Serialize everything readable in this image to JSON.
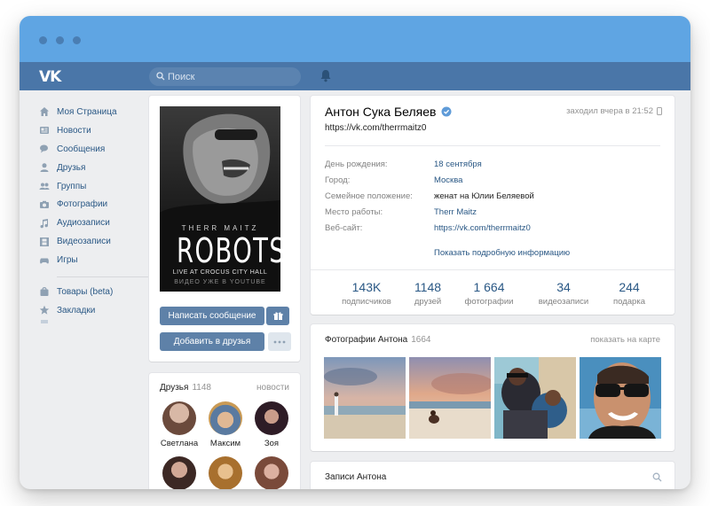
{
  "window": {
    "controls": [
      "close",
      "minimize",
      "maximize"
    ]
  },
  "header": {
    "logo": "VK",
    "search": {
      "placeholder": "Поиск"
    },
    "icons": [
      "search-icon",
      "bell-icon"
    ]
  },
  "sidebar": {
    "items": [
      {
        "label": "Моя Страница",
        "icon": "home-icon"
      },
      {
        "label": "Новости",
        "icon": "news-icon"
      },
      {
        "label": "Сообщения",
        "icon": "messages-icon"
      },
      {
        "label": "Друзья",
        "icon": "user-icon"
      },
      {
        "label": "Группы",
        "icon": "group-icon"
      },
      {
        "label": "Фотографии",
        "icon": "camera-icon"
      },
      {
        "label": "Аудиозаписи",
        "icon": "music-icon"
      },
      {
        "label": "Видеозаписи",
        "icon": "video-icon"
      },
      {
        "label": "Игры",
        "icon": "gamepad-icon"
      }
    ],
    "extra_items": [
      {
        "label": "Товары (beta)",
        "icon": "shopping-bag-icon"
      },
      {
        "label": "Закладки",
        "icon": "star-icon"
      }
    ]
  },
  "cover": {
    "brand": "THERR MAITZ",
    "title": "ROBOTS",
    "subtitle": "LIVE AT CROCUS CITY HALL",
    "note": "ВИДЕО УЖЕ В YOUTUBE"
  },
  "actions": {
    "message": "Написать сообщение",
    "add_friend": "Добавить в друзья",
    "gift_icon": "gift-icon",
    "more_icon": "more-icon"
  },
  "friends": {
    "title": "Друзья",
    "count": "1148",
    "link": "новости",
    "list": [
      {
        "name": "Светлана",
        "color": "#7a5a4a"
      },
      {
        "name": "Максим",
        "color": "#c6a06a"
      },
      {
        "name": "Зоя",
        "color": "#3a2a35"
      },
      {
        "name": "",
        "color": "#4a3530"
      },
      {
        "name": "",
        "color": "#b07a3a"
      },
      {
        "name": "",
        "color": "#8a5a4a"
      }
    ]
  },
  "profile": {
    "name": "Антон Сука Беляев",
    "verified": true,
    "online": "заходил вчера в 21:52",
    "online_icon": "mobile-icon",
    "url": "https://vk.com/therrmaitz0",
    "info": [
      {
        "label": "День рождения:",
        "value": "18 сентября",
        "style": "link"
      },
      {
        "label": "Город:",
        "value": "Москва",
        "style": "link"
      },
      {
        "label": "Семейное положение:",
        "value": "женат на Юлии Беляевой",
        "style": "dark"
      },
      {
        "label": "Место работы:",
        "value": "Therr Maitz",
        "style": "link"
      },
      {
        "label": "Веб-сайт:",
        "value": "https://vk.com/therrmaitz0",
        "style": "link"
      }
    ],
    "more_info": "Показать подробную информацию",
    "stats": [
      {
        "value": "143K",
        "label": "подписчиков"
      },
      {
        "value": "1148",
        "label": "друзей"
      },
      {
        "value": "1 664",
        "label": "фотографии"
      },
      {
        "value": "34",
        "label": "видеозаписи"
      },
      {
        "value": "244",
        "label": "подарка"
      }
    ]
  },
  "photos": {
    "title": "Фотографии Антона",
    "count": "1664",
    "link": "показать на карте",
    "items": [
      "beach-sunset",
      "beach-sitting",
      "family-beach",
      "selfie-sunglasses"
    ]
  },
  "posts": {
    "title": "Записи Антона"
  },
  "colors": {
    "header": "#4a76a8",
    "titlebar": "#5fa5e3",
    "link": "#2a5885",
    "background": "#edeef0"
  }
}
